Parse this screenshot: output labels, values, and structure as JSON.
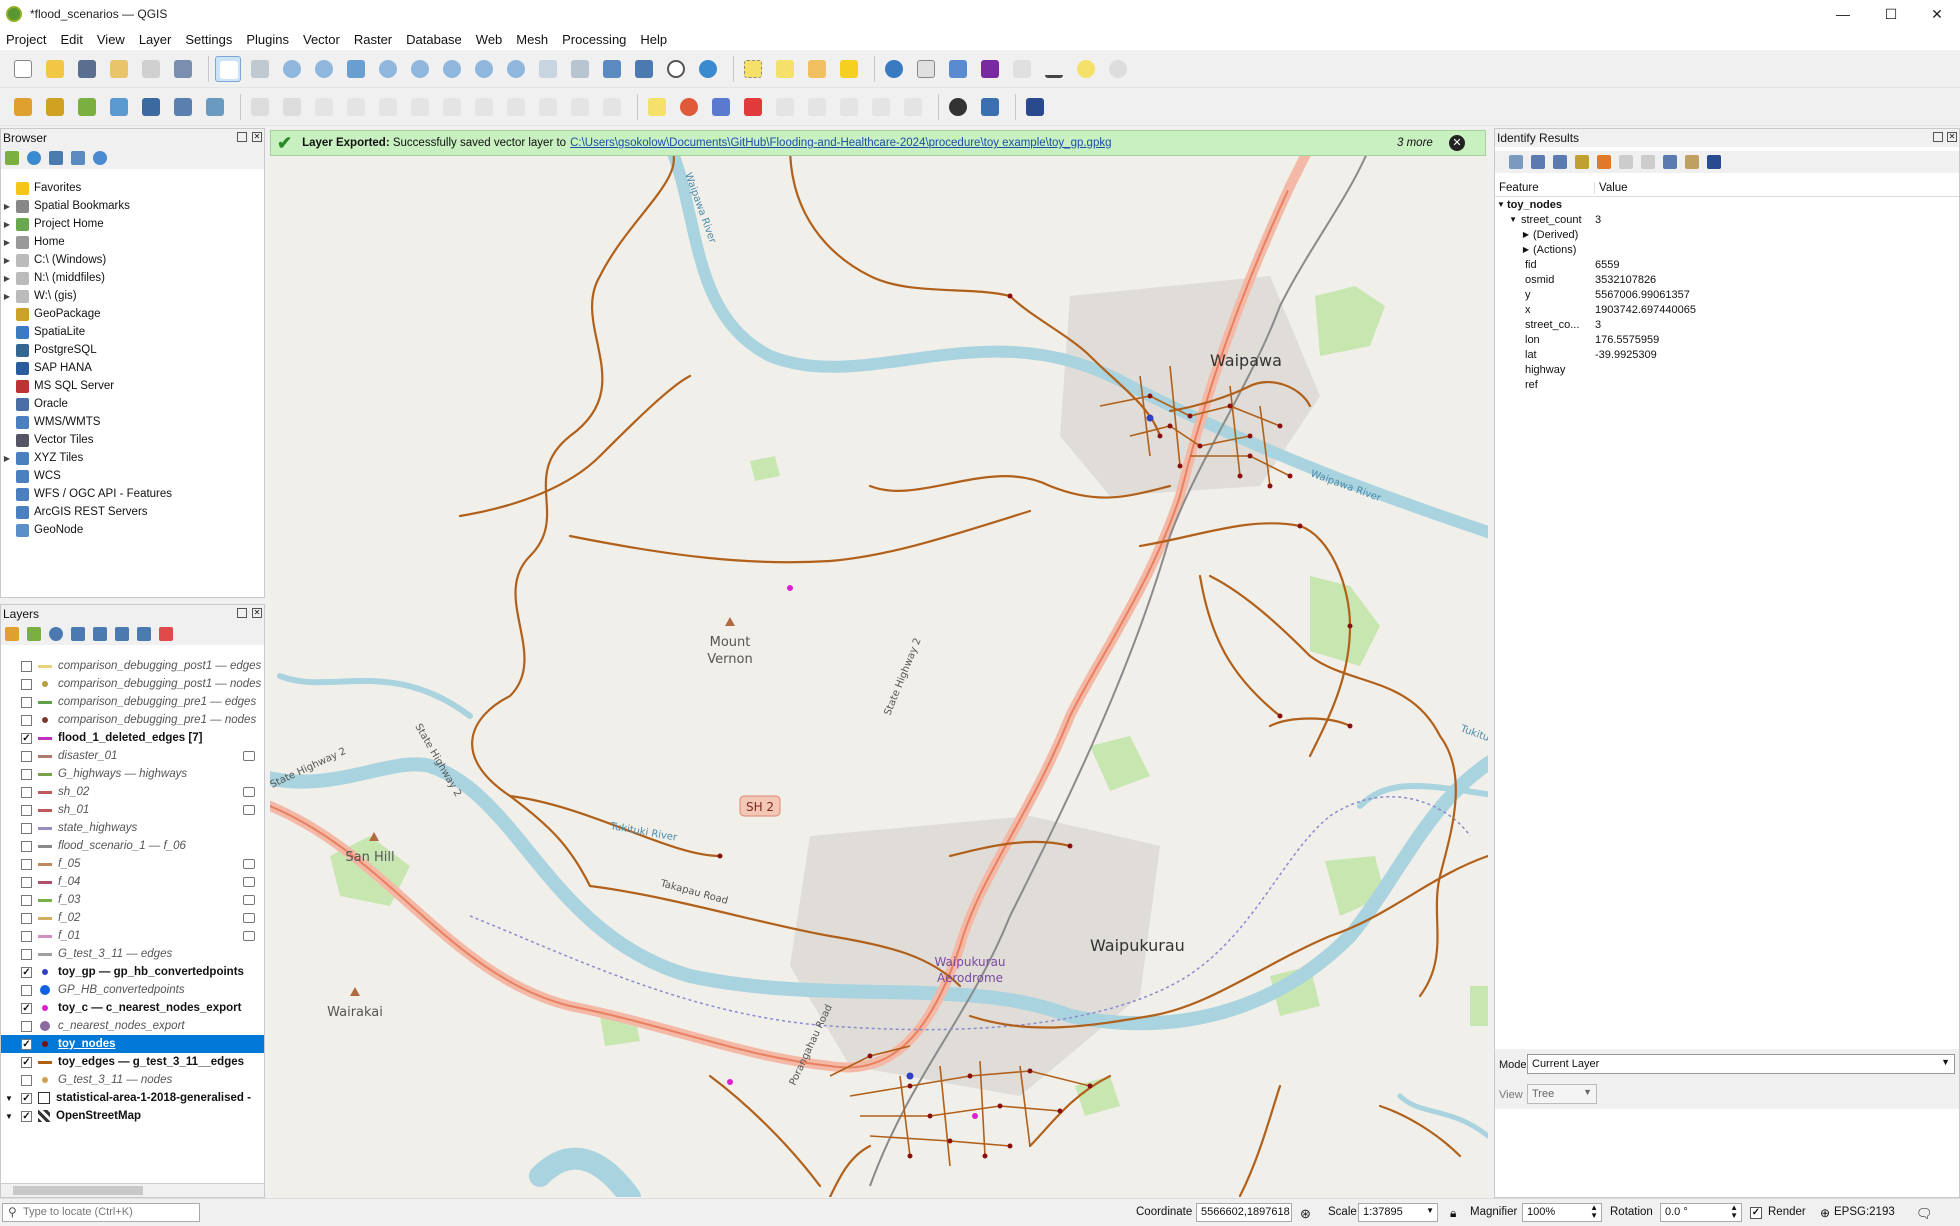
{
  "window": {
    "title": "*flood_scenarios — QGIS",
    "minimize": "—",
    "maximize": "☐",
    "close": "✕"
  },
  "menu": [
    "Project",
    "Edit",
    "View",
    "Layer",
    "Settings",
    "Plugins",
    "Vector",
    "Raster",
    "Database",
    "Web",
    "Mesh",
    "Processing",
    "Help"
  ],
  "browser": {
    "title": "Browser",
    "items": [
      {
        "label": "Favorites",
        "icon": "star-icon",
        "color": "#f5c518",
        "arrow": ""
      },
      {
        "label": "Spatial Bookmarks",
        "icon": "bookmark-icon",
        "color": "#888",
        "arrow": "▶"
      },
      {
        "label": "Project Home",
        "icon": "project-home-icon",
        "color": "#6aa84f",
        "arrow": "▶"
      },
      {
        "label": "Home",
        "icon": "home-icon",
        "color": "#999",
        "arrow": "▶"
      },
      {
        "label": "C:\\ (Windows)",
        "icon": "drive-icon",
        "color": "#bbb",
        "arrow": "▶"
      },
      {
        "label": "N:\\ (middfiles)",
        "icon": "drive-icon",
        "color": "#bbb",
        "arrow": "▶"
      },
      {
        "label": "W:\\ (gis)",
        "icon": "drive-icon",
        "color": "#bbb",
        "arrow": "▶"
      },
      {
        "label": "GeoPackage",
        "icon": "geopackage-icon",
        "color": "#c9a227",
        "arrow": ""
      },
      {
        "label": "SpatiaLite",
        "icon": "spatialite-icon",
        "color": "#3b7bbf",
        "arrow": ""
      },
      {
        "label": "PostgreSQL",
        "icon": "postgresql-icon",
        "color": "#336791",
        "arrow": ""
      },
      {
        "label": "SAP HANA",
        "icon": "sap-hana-icon",
        "color": "#2b5c9e",
        "arrow": ""
      },
      {
        "label": "MS SQL Server",
        "icon": "mssql-icon",
        "color": "#b33",
        "arrow": ""
      },
      {
        "label": "Oracle",
        "icon": "oracle-icon",
        "color": "#4a6fa5",
        "arrow": ""
      },
      {
        "label": "WMS/WMTS",
        "icon": "wms-icon",
        "color": "#4a7fc0",
        "arrow": ""
      },
      {
        "label": "Vector Tiles",
        "icon": "vector-tiles-icon",
        "color": "#556",
        "arrow": ""
      },
      {
        "label": "XYZ Tiles",
        "icon": "xyz-tiles-icon",
        "color": "#4a7fc0",
        "arrow": "▶"
      },
      {
        "label": "WCS",
        "icon": "wcs-icon",
        "color": "#4a7fc0",
        "arrow": ""
      },
      {
        "label": "WFS / OGC API - Features",
        "icon": "wfs-icon",
        "color": "#4a7fc0",
        "arrow": ""
      },
      {
        "label": "ArcGIS REST Servers",
        "icon": "arcgis-icon",
        "color": "#4a7fc0",
        "arrow": ""
      },
      {
        "label": "GeoNode",
        "icon": "geonode-icon",
        "color": "#5b8fc7",
        "arrow": ""
      }
    ]
  },
  "layers": {
    "title": "Layers",
    "items": [
      {
        "label": "comparison_debugging_post1 — edges",
        "checked": false,
        "sym": "line",
        "color": "#e8d37a",
        "filter": false,
        "sel": false
      },
      {
        "label": "comparison_debugging_post1 — nodes",
        "checked": false,
        "sym": "dot",
        "color": "#b8a040",
        "filter": false,
        "sel": false
      },
      {
        "label": "comparison_debugging_pre1 — edges",
        "checked": false,
        "sym": "line",
        "color": "#5fa04a",
        "filter": false,
        "sel": false
      },
      {
        "label": "comparison_debugging_pre1 — nodes",
        "checked": false,
        "sym": "dot",
        "color": "#7b3b2a",
        "filter": false,
        "sel": false
      },
      {
        "label": "flood_1_deleted_edges [7]",
        "checked": true,
        "sym": "line",
        "color": "#c030c0",
        "filter": false,
        "sel": false
      },
      {
        "label": "disaster_01",
        "checked": false,
        "sym": "line",
        "color": "#b07a70",
        "filter": true,
        "sel": false
      },
      {
        "label": "G_highways — highways",
        "checked": false,
        "sym": "line",
        "color": "#7aa24a",
        "filter": false,
        "sel": false
      },
      {
        "label": "sh_02",
        "checked": false,
        "sym": "line",
        "color": "#c05a5a",
        "filter": true,
        "sel": false
      },
      {
        "label": "sh_01",
        "checked": false,
        "sym": "line",
        "color": "#c05a5a",
        "filter": true,
        "sel": false
      },
      {
        "label": "state_highways",
        "checked": false,
        "sym": "line",
        "color": "#9a8ec0",
        "filter": false,
        "sel": false
      },
      {
        "label": "flood_scenario_1 — f_06",
        "checked": false,
        "sym": "line",
        "color": "#8a8a8a",
        "filter": false,
        "sel": false
      },
      {
        "label": "f_05",
        "checked": false,
        "sym": "line",
        "color": "#c08a60",
        "filter": true,
        "sel": false
      },
      {
        "label": "f_04",
        "checked": false,
        "sym": "line",
        "color": "#b0506a",
        "filter": true,
        "sel": false
      },
      {
        "label": "f_03",
        "checked": false,
        "sym": "line",
        "color": "#7ab04a",
        "filter": true,
        "sel": false
      },
      {
        "label": "f_02",
        "checked": false,
        "sym": "line",
        "color": "#d0b060",
        "filter": true,
        "sel": false
      },
      {
        "label": "f_01",
        "checked": false,
        "sym": "line",
        "color": "#d090c0",
        "filter": true,
        "sel": false
      },
      {
        "label": "G_test_3_11 — edges",
        "checked": false,
        "sym": "line",
        "color": "#a0a0a0",
        "filter": false,
        "sel": false
      },
      {
        "label": "toy_gp — gp_hb_convertedpoints",
        "checked": true,
        "sym": "dot",
        "color": "#3040c0",
        "filter": false,
        "sel": false
      },
      {
        "label": "GP_HB_convertedpoints",
        "checked": false,
        "sym": "bigdot",
        "color": "#1060e0",
        "filter": false,
        "sel": false
      },
      {
        "label": "toy_c — c_nearest_nodes_export",
        "checked": true,
        "sym": "dot",
        "color": "#e020d0",
        "filter": false,
        "sel": false
      },
      {
        "label": "c_nearest_nodes_export",
        "checked": false,
        "sym": "bigdot",
        "color": "#8a6aa0",
        "filter": false,
        "sel": false
      },
      {
        "label": "toy_nodes",
        "checked": true,
        "sym": "dot",
        "color": "#7a1010",
        "filter": false,
        "sel": true
      },
      {
        "label": "toy_edges — g_test_3_11__edges",
        "checked": true,
        "sym": "line",
        "color": "#b06010",
        "filter": false,
        "sel": false
      },
      {
        "label": "G_test_3_11 — nodes",
        "checked": false,
        "sym": "dot",
        "color": "#d0a050",
        "filter": false,
        "sel": false
      },
      {
        "label": "statistical-area-1-2018-generalised - ",
        "checked": true,
        "sym": "box",
        "color": "#ffffff",
        "filter": false,
        "sel": false
      },
      {
        "label": "OpenStreetMap",
        "checked": true,
        "sym": "osm",
        "color": "#333",
        "filter": false,
        "sel": false
      }
    ]
  },
  "banner": {
    "bold": "Layer Exported:",
    "text": "Successfully saved vector layer to",
    "link": "C:\\Users\\gsokolow\\Documents\\GitHub\\Flooding-and-Healthcare-2024\\procedure\\toy example\\toy_gp.gpkg",
    "more": "3 more"
  },
  "map": {
    "places": {
      "wai": "Waipawa",
      "waip": "Waipukurau",
      "mount1": "Mount",
      "mount2": "Vernon",
      "san": "San Hill",
      "wairakai": "Wairakai",
      "aero1": "Waipukurau",
      "aero2": "Aerodrome",
      "sh2": "SH 2",
      "sh2a": "State Highway 2",
      "sh2b": "State Highway 2",
      "sh2c": "State Highway 2",
      "river1": "Waipawa River",
      "river2": "Waipawa River",
      "river3": "Tukituki River",
      "river4": "Tukituki River",
      "road": "Takapau Road",
      "road2": "Porangahau Road"
    }
  },
  "identify": {
    "title": "Identify Results",
    "col_feature": "Feature",
    "col_value": "Value",
    "layer": "toy_nodes",
    "feature": "street_count",
    "feature_value": "3",
    "derived": "(Derived)",
    "actions": "(Actions)",
    "attrs": [
      {
        "f": "fid",
        "v": "6559"
      },
      {
        "f": "osmid",
        "v": "3532107826"
      },
      {
        "f": "y",
        "v": "5567006.99061357"
      },
      {
        "f": "x",
        "v": "1903742.697440065"
      },
      {
        "f": "street_co...",
        "v": "3"
      },
      {
        "f": "lon",
        "v": "176.5575959"
      },
      {
        "f": "lat",
        "v": "-39.9925309"
      },
      {
        "f": "highway",
        "v": ""
      },
      {
        "f": "ref",
        "v": ""
      }
    ],
    "mode_label": "Mode",
    "mode_value": "Current Layer",
    "view_label": "View",
    "view_value": "Tree"
  },
  "status": {
    "locate_placeholder": "Type to locate (Ctrl+K)",
    "coord_label": "Coordinate",
    "coord_value": "5566602,1897618",
    "scale_label": "Scale",
    "scale_value": "1:37895",
    "magnifier_label": "Magnifier",
    "magnifier_value": "100%",
    "rotation_label": "Rotation",
    "rotation_value": "0.0 °",
    "render_label": "Render",
    "crs": "EPSG:2193"
  }
}
